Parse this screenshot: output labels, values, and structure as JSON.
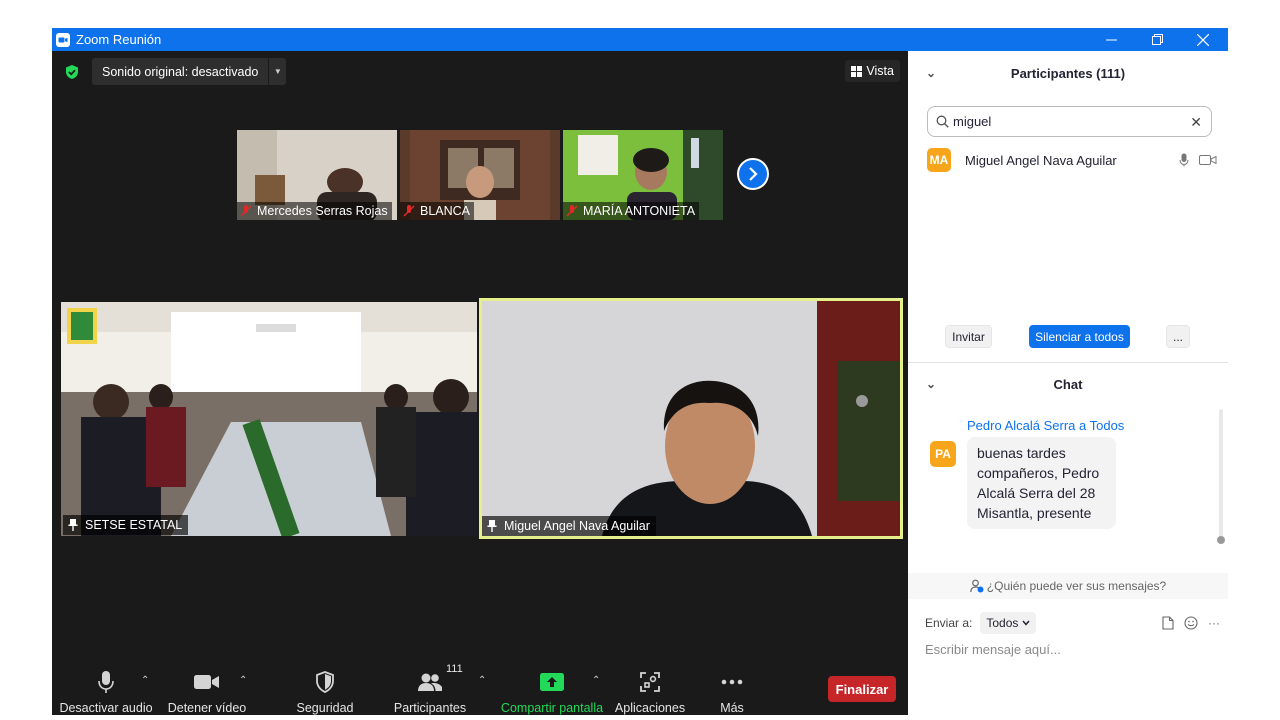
{
  "window": {
    "title": "Zoom Reunión",
    "minimize_glyph": "—",
    "restore_glyph": "❐",
    "close_glyph": "✕"
  },
  "meeting": {
    "sound_label": "Sonido original: desactivado",
    "sound_caret": "▼",
    "view_label": "Vista",
    "thumbnails": [
      {
        "name": "Mercedes Serras Rojas",
        "muted": true
      },
      {
        "name": "BLANCA",
        "muted": true
      },
      {
        "name": "MARÍA ANTONIETA",
        "muted": true
      }
    ],
    "main_videos": [
      {
        "name": "SETSE ESTATAL",
        "pinned": true
      },
      {
        "name": "Miguel Angel Nava Aguilar",
        "pinned": true,
        "active_speaker": true
      }
    ]
  },
  "toolbar": {
    "mute_label": "Desactivar audio",
    "video_label": "Detener vídeo",
    "security_label": "Seguridad",
    "participants_label": "Participantes",
    "participants_count": "111",
    "share_label": "Compartir pantalla",
    "apps_label": "Aplicaciones",
    "more_label": "Más",
    "end_label": "Finalizar",
    "caret": "⌃"
  },
  "participants_panel": {
    "title": "Participantes (111)",
    "search_value": "miguel",
    "clear_glyph": "✕",
    "collapse_glyph": "⌄",
    "results": [
      {
        "initials": "MA",
        "name": "Miguel Angel Nava Aguilar"
      }
    ],
    "invite_label": "Invitar",
    "mute_all_label": "Silenciar a todos",
    "more_label": "..."
  },
  "chat": {
    "title": "Chat",
    "messages": [
      {
        "sender": "Pedro Alcalá Serra a Todos",
        "initials": "PA",
        "text": "buenas tardes compañeros, Pedro Alcalá Serra del 28 Misantla, presente"
      }
    ],
    "who_sees": "¿Quién puede ver sus mensajes?",
    "send_to_label": "Enviar a:",
    "send_to_value": "Todos",
    "input_placeholder": "Escribir mensaje aquí...",
    "more_glyph": "···"
  },
  "colors": {
    "zoom_blue": "#0e72ed",
    "end_red": "#c72628",
    "share_green": "#23d959",
    "speaker_border": "#e6f08a",
    "avatar_orange": "#f7a51b"
  }
}
